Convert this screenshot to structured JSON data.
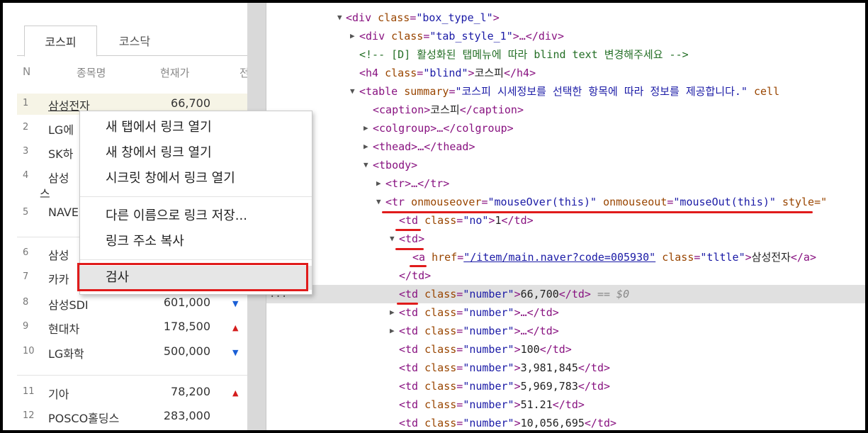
{
  "tabs": [
    "코스피",
    "코스닥"
  ],
  "table_headers": [
    "N",
    "종목명",
    "현재가",
    "전"
  ],
  "stocks": [
    {
      "no": "1",
      "name": "삼성전자",
      "price": "66,700",
      "dir": ""
    },
    {
      "no": "2",
      "name": "LG에",
      "price": "",
      "dir": ""
    },
    {
      "no": "3",
      "name": "SK하",
      "price": "",
      "dir": ""
    },
    {
      "no": "4",
      "name": "삼성",
      "name2": "스",
      "price": "",
      "dir": ""
    },
    {
      "no": "5",
      "name": "NAVE",
      "price": "",
      "dir": ""
    },
    {
      "no": "6",
      "name": "삼성",
      "price": "",
      "dir": ""
    },
    {
      "no": "7",
      "name": "카카",
      "price": "",
      "dir": ""
    },
    {
      "no": "8",
      "name": "삼성SDI",
      "price": "601,000",
      "dir": "down"
    },
    {
      "no": "9",
      "name": "현대차",
      "price": "178,500",
      "dir": "up"
    },
    {
      "no": "10",
      "name": "LG화학",
      "price": "500,000",
      "dir": "down"
    },
    {
      "no": "11",
      "name": "기아",
      "price": "78,200",
      "dir": "up"
    },
    {
      "no": "12",
      "name": "POSCO홀딩스",
      "price": "283,000",
      "dir": ""
    }
  ],
  "arrows": {
    "up": "▲",
    "down": "▼"
  },
  "context_menu": [
    "새 탭에서 링크 열기",
    "새 창에서 링크 열기",
    "시크릿 창에서 링크 열기",
    "다른 이름으로 링크 저장...",
    "링크 주소 복사",
    "검사"
  ],
  "dom": {
    "l0": {
      "tag_open": "<div ",
      "attr": "class",
      "eq": "=",
      "val": "\"box_type_l\"",
      "close": ">"
    },
    "l1": {
      "tag_open": "<div ",
      "attr": "class",
      "eq": "=",
      "val": "\"tab_style_1\"",
      "close": ">…</div>"
    },
    "l2": {
      "comment": "<!-- [D] 활성화된 탭메뉴에 따라 blind text 변경해주세요 -->"
    },
    "l3": {
      "tag_open": "<h4 ",
      "attr": "class",
      "eq": "=",
      "val": "\"blind\"",
      "close": ">",
      "text": "코스피",
      "end": "</h4>"
    },
    "l4": {
      "tag_open": "<table ",
      "attr": "summary",
      "eq": "=",
      "val": "\"코스피 시세정보를 선택한 항목에 따라 정보를 제공합니다.\"",
      "tail": " cell"
    },
    "l5": {
      "tag_open": "<caption>",
      "text": "코스피",
      "end": "</caption>"
    },
    "l6": {
      "tag_open": "<colgroup>…</colgroup>"
    },
    "l7": {
      "tag_open": "<thead>…</thead>"
    },
    "l8": {
      "tag_open": "<tbody>"
    },
    "l9": {
      "tag_open": "<tr>…</tr>"
    },
    "l10": {
      "tag_open": "<tr ",
      "attr1": "onmouseover",
      "val1": "\"mouseOver(this)\"",
      "attr2": "onmouseout",
      "val2": "\"mouseOut(this)\"",
      "tail": "style=\""
    },
    "l11": {
      "tag_open": "<td ",
      "attr": "class",
      "eq": "=",
      "val": "\"no\"",
      "close": ">",
      "text": "1",
      "end": "</td>"
    },
    "l12": {
      "tag_open": "<td>"
    },
    "l13": {
      "tag_open": "<a ",
      "attr": "href",
      "eq": "=",
      "val": "\"/item/main.naver?code=005930\"",
      "attr2": "class",
      "val2": "\"tltle\"",
      "close": ">",
      "text": "삼성전자",
      "end": "</a>"
    },
    "l14": {
      "tag_open": "</td>"
    },
    "l15": {
      "tag_open": "<td ",
      "attr": "class",
      "eq": "=",
      "val": "\"number\"",
      "close": ">",
      "text": "66,700",
      "end": "</td>",
      "marker": "== $0",
      "dots": "..."
    },
    "rows": [
      {
        "tag_open": "<td ",
        "attr": "class",
        "val": "\"number\"",
        "close": ">…</td>"
      },
      {
        "tag_open": "<td ",
        "attr": "class",
        "val": "\"number\"",
        "close": ">…</td>"
      },
      {
        "tag_open": "<td ",
        "attr": "class",
        "val": "\"number\"",
        "close": ">",
        "text": "100",
        "end": "</td>"
      },
      {
        "tag_open": "<td ",
        "attr": "class",
        "val": "\"number\"",
        "close": ">",
        "text": "3,981,845",
        "end": "</td>"
      },
      {
        "tag_open": "<td ",
        "attr": "class",
        "val": "\"number\"",
        "close": ">",
        "text": "5,969,783",
        "end": "</td>"
      },
      {
        "tag_open": "<td ",
        "attr": "class",
        "val": "\"number\"",
        "close": ">",
        "text": "51.21",
        "end": "</td>"
      },
      {
        "tag_open": "<td ",
        "attr": "class",
        "val": "\"number\"",
        "close": ">",
        "text": "10,056,695",
        "end": "</td>"
      }
    ]
  }
}
